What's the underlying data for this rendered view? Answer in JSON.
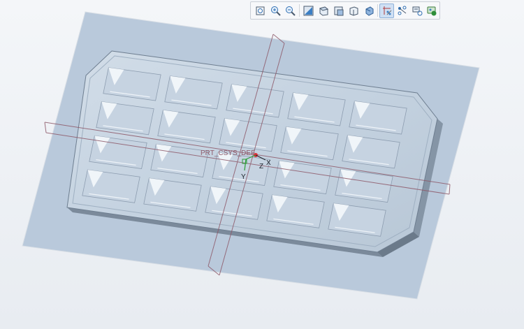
{
  "toolbar": {
    "buttons": [
      {
        "icon": "refit-icon",
        "active": false
      },
      {
        "icon": "zoom-in-icon",
        "active": false
      },
      {
        "icon": "zoom-out-icon",
        "active": false
      },
      {
        "icon": "repaint-icon",
        "active": false
      },
      {
        "icon": "view-manager-icon",
        "active": false
      },
      {
        "icon": "saved-orientations-icon",
        "active": false
      },
      {
        "icon": "display-style-icon",
        "active": false
      },
      {
        "icon": "section-icon",
        "active": false
      },
      {
        "icon": "datum-display-filters-icon",
        "active": true
      },
      {
        "icon": "annotation-display-icon",
        "active": false
      },
      {
        "icon": "spin-center-icon",
        "active": false
      },
      {
        "icon": "appearance-gallery-icon",
        "active": false
      }
    ]
  },
  "model": {
    "csys_label": "PRT_CSYS_DEF",
    "axis_x": "X",
    "axis_y": "Y",
    "axis_z": "Z"
  },
  "colors": {
    "datum_plane_fill": "#b9c9db",
    "part_surface": "#c3d2e1",
    "part_edge": "#6e7e90",
    "datum_line": "#8e5a6a",
    "csys_red": "#e0303a",
    "csys_green": "#2c9e3a"
  }
}
